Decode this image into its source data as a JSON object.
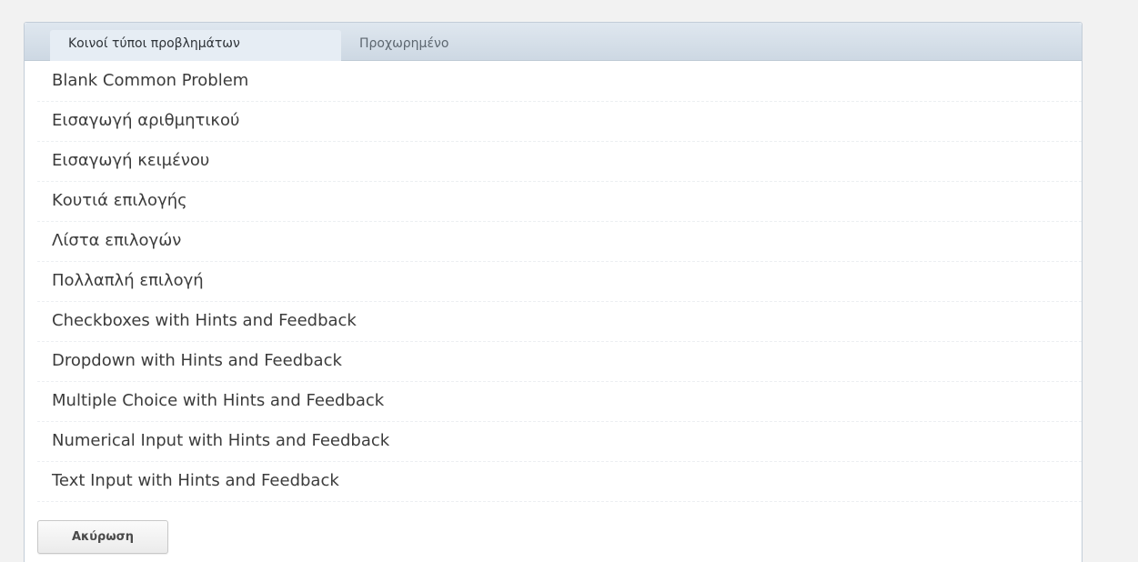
{
  "tabs": {
    "common": "Κοινοί τύποι προβλημάτων",
    "advanced": "Προχωρημένο"
  },
  "problem_types": [
    "Blank Common Problem",
    "Εισαγωγή αριθμητικού",
    "Εισαγωγή κειμένου",
    "Κουτιά επιλογής",
    "Λίστα επιλογών",
    "Πολλαπλή επιλογή",
    "Checkboxes with Hints and Feedback",
    "Dropdown with Hints and Feedback",
    "Multiple Choice with Hints and Feedback",
    "Numerical Input with Hints and Feedback",
    "Text Input with Hints and Feedback"
  ],
  "actions": {
    "cancel": "Ακύρωση"
  }
}
